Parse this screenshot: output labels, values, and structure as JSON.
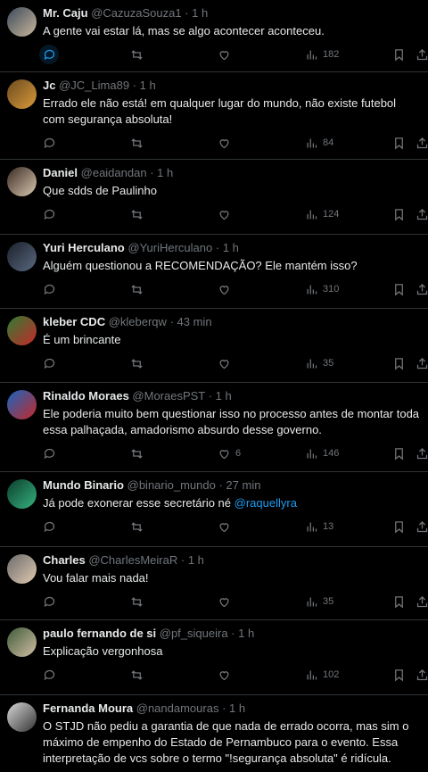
{
  "tweets": [
    {
      "name": "Mr. Caju",
      "handle": "@CazuzaSouza1",
      "time": "1 h",
      "text": "A gente vai estar lá, mas se algo acontecer aconteceu.",
      "likes": "",
      "views": "182",
      "avatar_colors": [
        "#3b4a5a",
        "#c9b79c"
      ]
    },
    {
      "name": "Jc",
      "handle": "@JC_Lima89",
      "time": "1 h",
      "text": "Errado ele não está! em qualquer lugar do mundo, não existe futebol com segurança absoluta!",
      "likes": "",
      "views": "84",
      "avatar_colors": [
        "#6b4a1f",
        "#d99a3a"
      ]
    },
    {
      "name": "Daniel",
      "handle": "@eaidandan",
      "time": "1 h",
      "text": "Que sdds de Paulinho",
      "likes": "",
      "views": "124",
      "avatar_colors": [
        "#3a2a22",
        "#d8c7b0"
      ]
    },
    {
      "name": "Yuri Herculano",
      "handle": "@YuriHerculano",
      "time": "1 h",
      "text": "Alguém questionou a RECOMENDAÇÃO? Ele mantém isso?",
      "likes": "",
      "views": "310",
      "avatar_colors": [
        "#1a1f2a",
        "#5a6a80"
      ]
    },
    {
      "name": "kleber CDC",
      "handle": "@kleberqw",
      "time": "43 min",
      "text": "É um brincante",
      "likes": "",
      "views": "35",
      "avatar_colors": [
        "#2e7d32",
        "#c62828"
      ]
    },
    {
      "name": "Rinaldo Moraes",
      "handle": "@MoraesPST",
      "time": "1 h",
      "text": "Ele poderia muito bem questionar isso no processo antes de montar toda essa palhaçada, amadorismo absurdo desse governo.",
      "likes": "6",
      "views": "146",
      "avatar_colors": [
        "#1565c0",
        "#c62828"
      ]
    },
    {
      "name": "Mundo Binario",
      "handle": "@binario_mundo",
      "time": "27 min",
      "text": "Já pode exonerar esse secretário né",
      "mention": "@raquellyra",
      "likes": "",
      "views": "13",
      "avatar_colors": [
        "#0b3d2e",
        "#36b37e"
      ]
    },
    {
      "name": "Charles",
      "handle": "@CharlesMeiraR",
      "time": "1 h",
      "text": "Vou falar mais nada!",
      "likes": "",
      "views": "35",
      "avatar_colors": [
        "#6b6b6b",
        "#e0c9b0"
      ]
    },
    {
      "name": "paulo fernando de si",
      "handle": "@pf_siqueira",
      "time": "1 h",
      "text": "Explicação vergonhosa",
      "likes": "",
      "views": "102",
      "avatar_colors": [
        "#3f5a3a",
        "#d1bfa4"
      ]
    },
    {
      "name": "Fernanda Moura",
      "handle": "@nandamouras",
      "time": "1 h",
      "text": "O STJD não pediu a garantia de que nada de errado ocorra, mas sim o máximo de empenho do Estado de Pernambuco para o evento. Essa interpretação de vcs sobre o termo \"!segurança absoluta\" é ridícula.",
      "likes": "",
      "views": "",
      "avatar_colors": [
        "#d7d7d7",
        "#333333"
      ]
    }
  ],
  "separator": "·",
  "icons": [
    "reply-icon",
    "retweet-icon",
    "like-icon",
    "views-icon",
    "bookmark-icon",
    "share-icon"
  ],
  "accent": "#1d9bf0"
}
